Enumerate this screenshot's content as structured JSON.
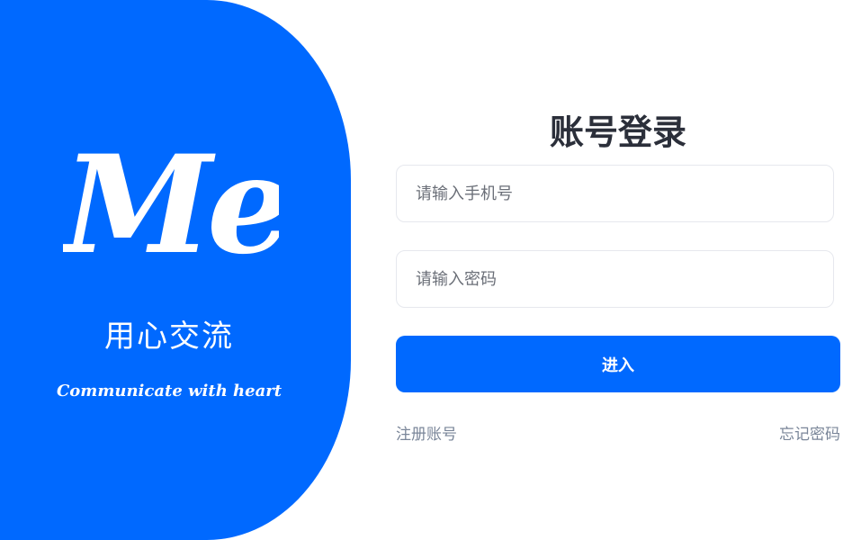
{
  "brand": {
    "logo_text": "Me",
    "tagline_cn": "用心交流",
    "tagline_en": "Communicate with heart",
    "panel_color": "#0069ff"
  },
  "login": {
    "title": "账号登录",
    "phone_placeholder": "请输入手机号",
    "password_placeholder": "请输入密码",
    "submit_label": "进入",
    "register_link": "注册账号",
    "forgot_link": "忘记密码"
  }
}
